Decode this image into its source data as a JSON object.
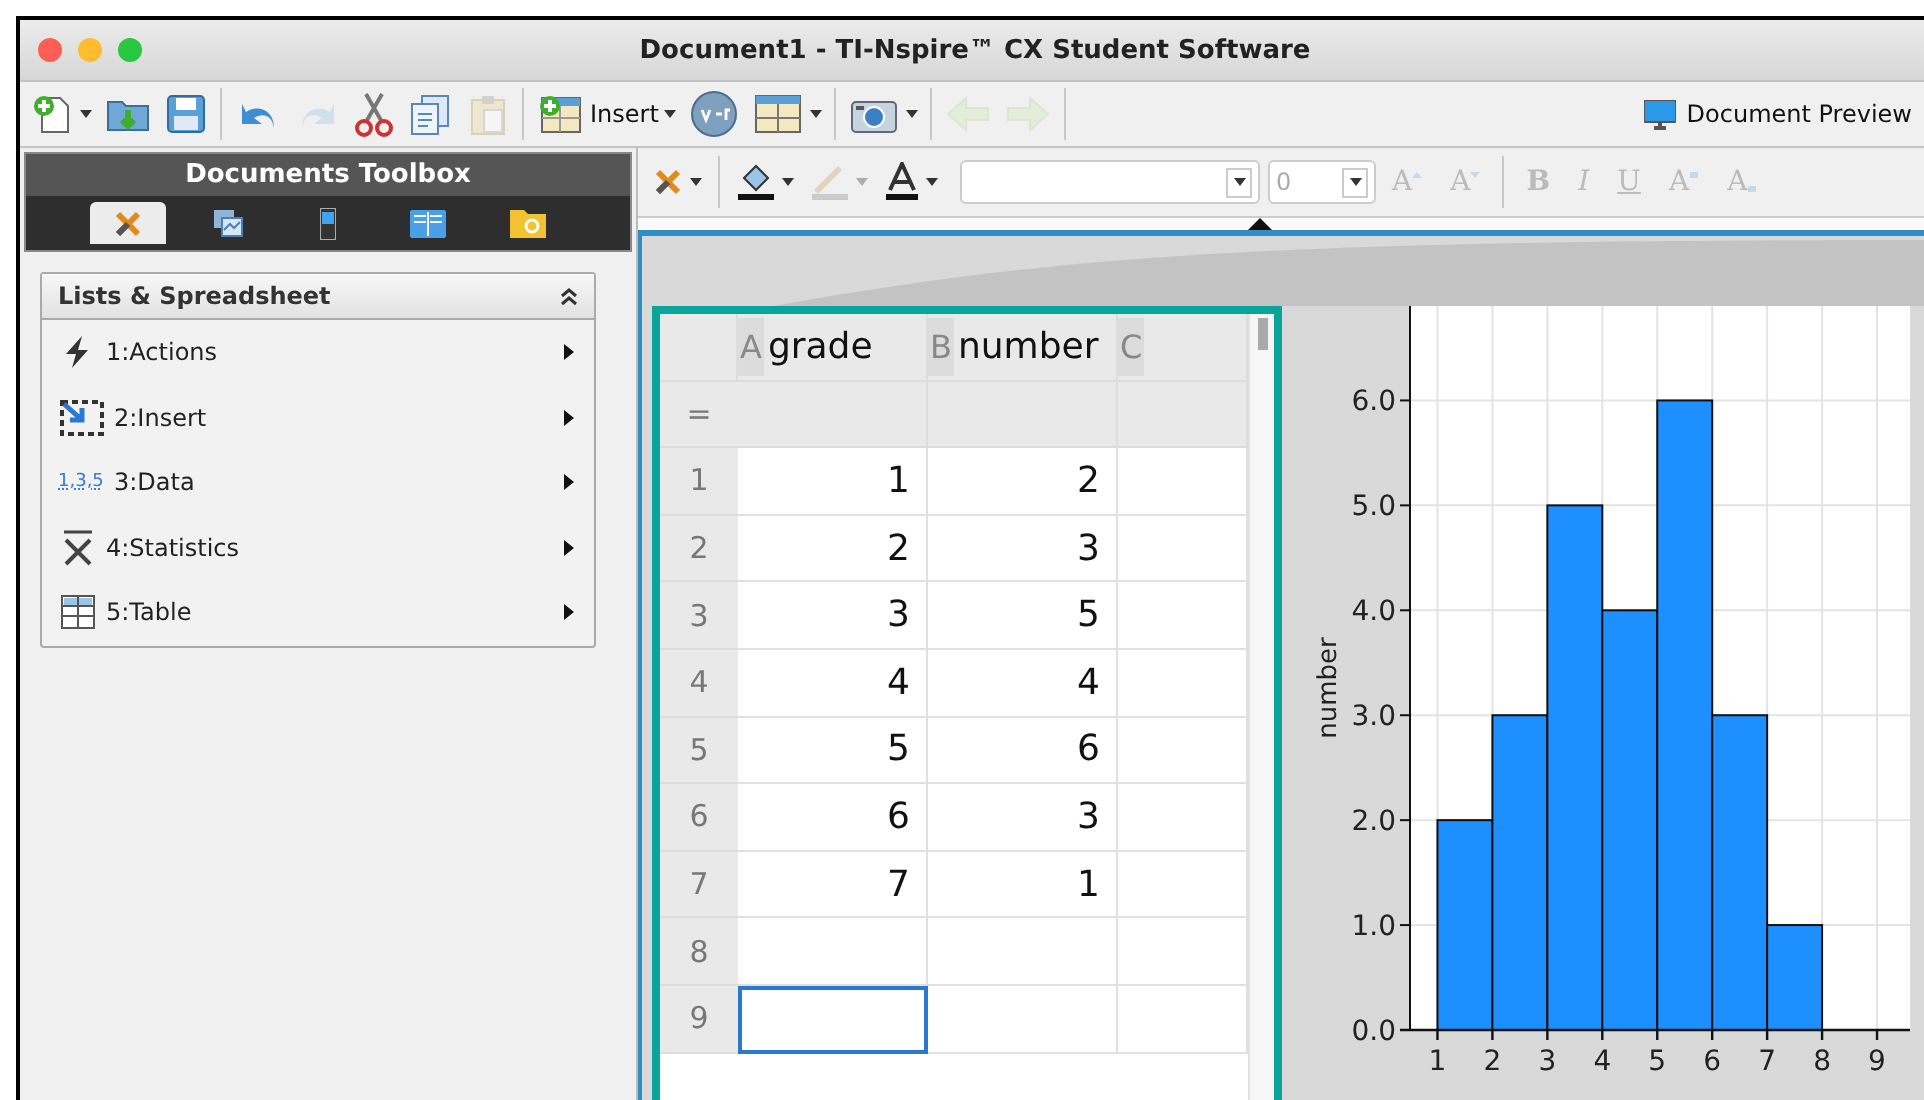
{
  "window": {
    "title": "Document1 - TI-Nspire™ CX Student Software"
  },
  "toolbar": {
    "buttons": [
      {
        "disabled": false,
        "dropdown": true
      },
      {
        "disabled": false,
        "dropdown": false
      },
      {
        "disabled": false,
        "dropdown": false
      },
      {
        "disabled": false,
        "dropdown": false
      },
      {
        "disabled": true,
        "dropdown": false
      },
      {
        "disabled": false,
        "dropdown": false
      },
      {
        "disabled": false,
        "dropdown": false
      },
      {
        "disabled": true,
        "dropdown": false
      },
      {
        "disabled": false,
        "dropdown": true,
        "label": "Insert"
      },
      {
        "disabled": false,
        "dropdown": false
      },
      {
        "disabled": false,
        "dropdown": true
      },
      {
        "disabled": false,
        "dropdown": true
      },
      {
        "disabled": true,
        "dropdown": false
      },
      {
        "disabled": true,
        "dropdown": false
      }
    ],
    "preview": {
      "label": "Document Preview"
    }
  },
  "toolbox": {
    "title": "Documents Toolbox",
    "tabs": [
      {
        "selected": true
      },
      {
        "selected": false
      },
      {
        "selected": false
      },
      {
        "selected": false
      },
      {
        "selected": false
      }
    ],
    "panel": {
      "title": "Lists & Spreadsheet",
      "items": [
        {
          "label": "1:Actions"
        },
        {
          "label": "2:Insert"
        },
        {
          "label": "3:Data",
          "icon_text": "1,3,5"
        },
        {
          "label": "4:Statistics"
        },
        {
          "label": "5:Table"
        }
      ]
    }
  },
  "format_bar": {
    "size_value": "0",
    "buttons": [
      {
        "label": "A",
        "disabled": true
      },
      {
        "label": "A",
        "disabled": true
      },
      {
        "label": "B",
        "disabled": true
      },
      {
        "label": "I",
        "disabled": true
      },
      {
        "label": "U",
        "disabled": true
      },
      {
        "label": "A",
        "disabled": true
      },
      {
        "label": "A",
        "disabled": true
      }
    ]
  },
  "spreadsheet": {
    "formula_row_label": "=",
    "columns": [
      {
        "letter": "A",
        "name": "grade"
      },
      {
        "letter": "B",
        "name": "number"
      },
      {
        "letter": "C"
      }
    ],
    "rows": [
      {
        "label": "1",
        "cells": [
          {
            "value": "1",
            "selected": false
          },
          {
            "value": "2",
            "selected": false
          },
          {
            "selected": false
          }
        ]
      },
      {
        "label": "2",
        "cells": [
          {
            "value": "2",
            "selected": false
          },
          {
            "value": "3",
            "selected": false
          },
          {
            "selected": false
          }
        ]
      },
      {
        "label": "3",
        "cells": [
          {
            "value": "3",
            "selected": false
          },
          {
            "value": "5",
            "selected": false
          },
          {
            "selected": false
          }
        ]
      },
      {
        "label": "4",
        "cells": [
          {
            "value": "4",
            "selected": false
          },
          {
            "value": "4",
            "selected": false
          },
          {
            "selected": false
          }
        ]
      },
      {
        "label": "5",
        "cells": [
          {
            "value": "5",
            "selected": false
          },
          {
            "value": "6",
            "selected": false
          },
          {
            "selected": false
          }
        ]
      },
      {
        "label": "6",
        "cells": [
          {
            "value": "6",
            "selected": false
          },
          {
            "value": "3",
            "selected": false
          },
          {
            "selected": false
          }
        ]
      },
      {
        "label": "7",
        "cells": [
          {
            "value": "7",
            "selected": false
          },
          {
            "value": "1",
            "selected": false
          },
          {
            "selected": false
          }
        ]
      },
      {
        "label": "8",
        "cells": [
          {
            "selected": false
          },
          {
            "selected": false
          },
          {
            "selected": false
          }
        ]
      },
      {
        "label": "9",
        "cells": [
          {
            "selected": true
          },
          {
            "selected": false
          },
          {
            "selected": false
          }
        ]
      }
    ]
  },
  "graph": {
    "chart_data": {
      "type": "bar",
      "ylabel": "number",
      "x": [
        1.5,
        2.5,
        3.5,
        4.5,
        5.5,
        6.5,
        7.5
      ],
      "series": [
        {
          "color": "#1e8fff",
          "values": [
            2,
            3,
            5,
            4,
            6,
            3,
            1
          ]
        }
      ],
      "grid": true,
      "xlim": [
        0.5,
        9.6
      ],
      "ylim": [
        0,
        6.9
      ],
      "xticks": [
        1,
        2,
        3,
        4,
        5,
        6,
        7,
        8,
        9
      ],
      "yticks": [
        {
          "value": 0,
          "label": "0.0"
        },
        {
          "value": 1,
          "label": "1.0"
        },
        {
          "value": 2,
          "label": "2.0"
        },
        {
          "value": 3,
          "label": "3.0"
        },
        {
          "value": 4,
          "label": "4.0"
        },
        {
          "value": 5,
          "label": "5.0"
        },
        {
          "value": 6,
          "label": "6.0"
        }
      ]
    }
  }
}
